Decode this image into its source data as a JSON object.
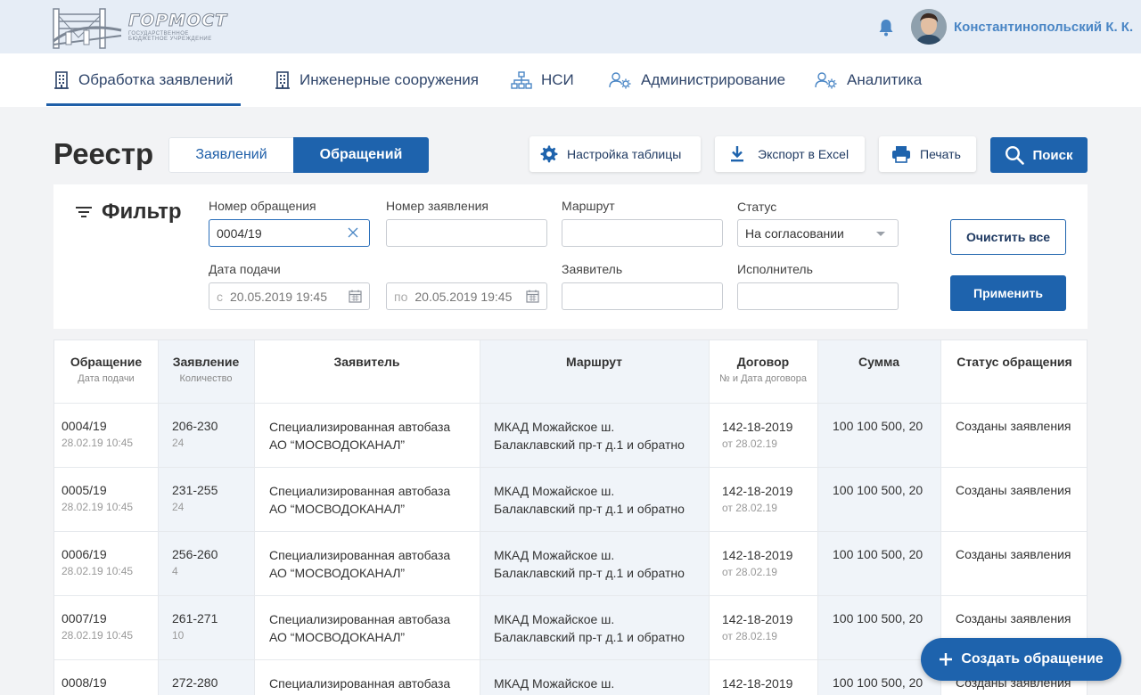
{
  "header": {
    "logo_text": "ГОРМОСТ",
    "logo_subtitle": "ГОСУДАРСТВЕННОЕ БЮДЖЕТНОЕ УЧРЕЖДЕНИЕ",
    "username": "Константинопольский К. К."
  },
  "nav": {
    "items": [
      {
        "label": "Обработка заявлений",
        "icon": "building-icon",
        "active": true
      },
      {
        "label": "Инженерные сооружения",
        "icon": "building-icon",
        "active": false
      },
      {
        "label": "НСИ",
        "icon": "hierarchy-icon",
        "active": false
      },
      {
        "label": "Администрирование",
        "icon": "users-gear-icon",
        "active": false
      },
      {
        "label": "Аналитика",
        "icon": "users-gear-icon",
        "active": false
      }
    ]
  },
  "registry": {
    "title": "Реестр",
    "tabs": [
      {
        "label": "Заявлений",
        "selected": false
      },
      {
        "label": "Обращений",
        "selected": true
      }
    ],
    "toolbar": {
      "settings_label": "Настройка таблицы",
      "export_label": "Экспорт в Excel",
      "print_label": "Печать",
      "search_label": "Поиск"
    }
  },
  "filter": {
    "title": "Фильтр",
    "request_number": {
      "label": "Номер обращения",
      "value": "0004/19"
    },
    "application_number": {
      "label": "Номер заявления",
      "value": ""
    },
    "route": {
      "label": "Маршрут",
      "value": ""
    },
    "status": {
      "label": "Статус",
      "value": "На согласовании"
    },
    "submit_date": {
      "label": "Дата подачи",
      "from_prefix": "с",
      "from_value": "20.05.2019 19:45",
      "to_prefix": "по",
      "to_value": "20.05.2019 19:45"
    },
    "applicant": {
      "label": "Заявитель",
      "value": ""
    },
    "executor": {
      "label": "Исполнитель",
      "value": ""
    },
    "clear_label": "Очистить все",
    "apply_label": "Применить"
  },
  "table": {
    "headers": [
      {
        "title": "Обращение",
        "sub": "Дата подачи"
      },
      {
        "title": "Заявление",
        "sub": "Количество"
      },
      {
        "title": "Заявитель",
        "sub": ""
      },
      {
        "title": "Маршрут",
        "sub": ""
      },
      {
        "title": "Договор",
        "sub": "№ и Дата договора"
      },
      {
        "title": "Сумма",
        "sub": ""
      },
      {
        "title": "Статус обращения",
        "sub": ""
      }
    ],
    "rows": [
      {
        "request": "0004/19",
        "date": "28.02.19 10:45",
        "application": "206-230",
        "count": "24",
        "applicant1": "Специализированная автобаза",
        "applicant2": "АО “МОСВОДОКАНАЛ”",
        "route1": "МКАД Можайское ш.",
        "route2": "Балаклавский пр-т д.1 и обратно",
        "contract": "142-18-2019",
        "contract_date": "от 28.02.19",
        "sum": "100 100 500, 20",
        "status": "Созданы заявления"
      },
      {
        "request": "0005/19",
        "date": "28.02.19 10:45",
        "application": "231-255",
        "count": "24",
        "applicant1": "Специализированная автобаза",
        "applicant2": "АО “МОСВОДОКАНАЛ”",
        "route1": "МКАД Можайское ш.",
        "route2": "Балаклавский пр-т д.1 и обратно",
        "contract": "142-18-2019",
        "contract_date": "от 28.02.19",
        "sum": "100 100 500, 20",
        "status": "Созданы заявления"
      },
      {
        "request": "0006/19",
        "date": "28.02.19 10:45",
        "application": "256-260",
        "count": "4",
        "applicant1": "Специализированная автобаза",
        "applicant2": "АО “МОСВОДОКАНАЛ”",
        "route1": "МКАД Можайское ш.",
        "route2": "Балаклавский пр-т д.1 и обратно",
        "contract": "142-18-2019",
        "contract_date": "от 28.02.19",
        "sum": "100 100 500, 20",
        "status": "Созданы заявления"
      },
      {
        "request": "0007/19",
        "date": "28.02.19 10:45",
        "application": "261-271",
        "count": "10",
        "applicant1": "Специализированная автобаза",
        "applicant2": "АО “МОСВОДОКАНАЛ”",
        "route1": "МКАД Можайское ш.",
        "route2": "Балаклавский пр-т д.1 и обратно",
        "contract": "142-18-2019",
        "contract_date": "от 28.02.19",
        "sum": "100 100 500, 20",
        "status": "Созданы заявления"
      },
      {
        "request": "0008/19",
        "date": "",
        "application": "272-280",
        "count": "",
        "applicant1": "Специализированная автобаза",
        "applicant2": "",
        "route1": "МКАД Можайское ш.",
        "route2": "",
        "contract": "142-18-2019",
        "contract_date": "",
        "sum": "100 100 500, 20",
        "status": "Созданы заявления"
      }
    ]
  },
  "fab": {
    "label": "Создать обращение"
  },
  "colors": {
    "accent": "#1e63ad",
    "header_bg": "#e6edf6",
    "nav_text": "#30466b"
  }
}
